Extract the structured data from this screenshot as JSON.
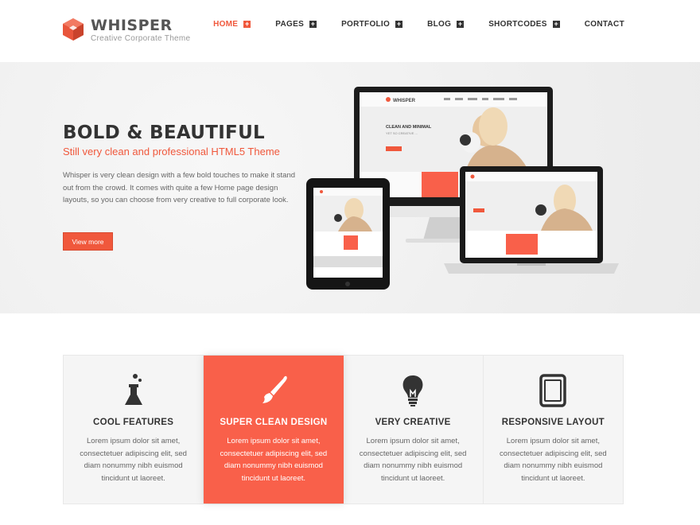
{
  "brand": {
    "title": "WHISPER",
    "tagline": "Creative  Corporate Theme",
    "accent_color": "#f0583c"
  },
  "nav": {
    "items": [
      {
        "label": "HOME",
        "has_dropdown": true,
        "active": true
      },
      {
        "label": "PAGES",
        "has_dropdown": true
      },
      {
        "label": "PORTFOLIO",
        "has_dropdown": true
      },
      {
        "label": "BLOG",
        "has_dropdown": true
      },
      {
        "label": "SHORTCODES",
        "has_dropdown": true
      },
      {
        "label": "CONTACT",
        "has_dropdown": false
      }
    ],
    "dropdown_glyph": "+"
  },
  "hero": {
    "title": "BOLD & BEAUTIFUL",
    "subtitle": "Still very clean and professional HTML5 Theme",
    "body": "Whisper is very clean design with a few bold touches to make it stand out from the crowd. It comes with quite a few Home page design layouts, so you can choose from very creative to full corporate look.",
    "button_label": "View more",
    "device_mockup": {
      "screen_heading": "CLEAN AND MINIMAL",
      "screen_subheading": "YET SO CREATIVE ...",
      "screen_brand": "WHISPER"
    }
  },
  "features": [
    {
      "icon": "flask-icon",
      "title": "COOL FEATURES",
      "text": "Lorem ipsum dolor sit amet, consectetuer adipiscing elit, sed diam nonummy nibh euismod tincidunt ut laoreet."
    },
    {
      "icon": "brush-icon",
      "title": "SUPER CLEAN DESIGN",
      "text": "Lorem ipsum dolor sit amet, consectetuer adipiscing elit, sed diam nonummy nibh euismod tincidunt ut laoreet.",
      "highlighted": true
    },
    {
      "icon": "lightbulb-icon",
      "title": "VERY CREATIVE",
      "text": "Lorem ipsum dolor sit amet, consectetuer adipiscing elit, sed diam nonummy nibh euismod tincidunt ut laoreet."
    },
    {
      "icon": "tablet-icon",
      "title": "RESPONSIVE LAYOUT",
      "text": "Lorem ipsum dolor sit amet, consectetuer adipiscing elit, sed diam nonummy nibh euismod tincidunt ut laoreet."
    }
  ]
}
